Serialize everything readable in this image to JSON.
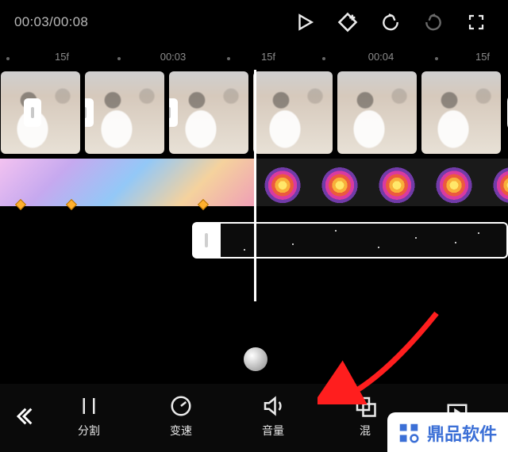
{
  "top": {
    "timecode": "00:03/00:08"
  },
  "ruler": {
    "tick1": "15f",
    "tick2": "00:03",
    "tick3": "15f",
    "tick4": "00:04",
    "tick5": "15f"
  },
  "timeline": {
    "add_label": "+",
    "overlay_handle": "|"
  },
  "tools": {
    "split": "分割",
    "speed": "变速",
    "volume": "音量",
    "blend": "混",
    "last": ""
  },
  "watermark": {
    "text": "鼎品软件"
  }
}
